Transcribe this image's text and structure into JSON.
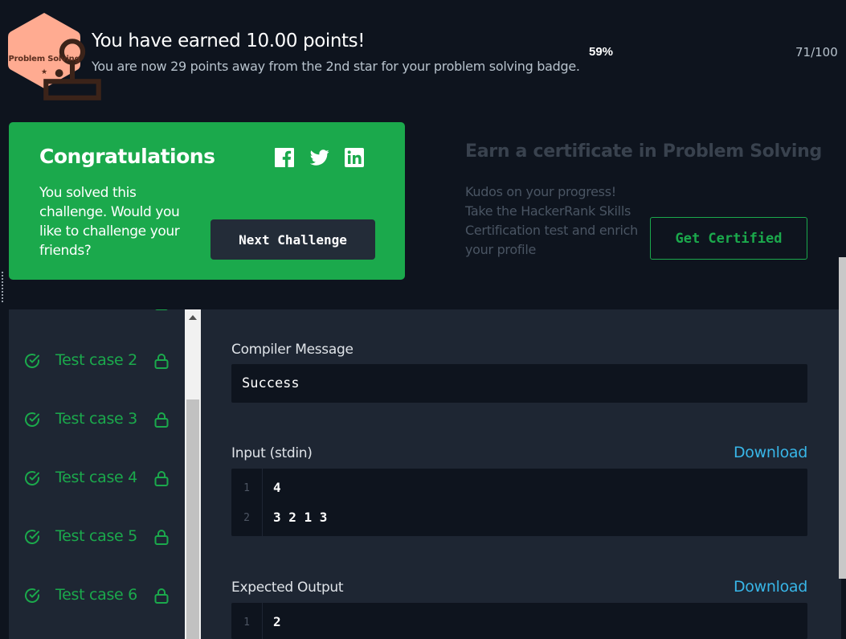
{
  "badge": {
    "name": "Problem Solving",
    "star": "★"
  },
  "points": {
    "earned_text": "You have earned 10.00 points!",
    "away_text": "You are now 29 points away from the 2nd star for your problem solving badge.",
    "percent": "59%",
    "score": "71/100",
    "progress_fraction": 0.59
  },
  "congrats": {
    "title": "Congratulations",
    "text": "You solved this challenge. Would you like to challenge your friends?",
    "next_button": "Next Challenge",
    "social_icons": [
      "facebook-icon",
      "twitter-icon",
      "linkedin-icon"
    ]
  },
  "certificate": {
    "title": "Earn a certificate in Problem Solving",
    "text": "Kudos on your progress! Take the HackerRank Skills Certification test and enrich your profile",
    "button": "Get Certified"
  },
  "test_cases": [
    {
      "label": "Test case 2"
    },
    {
      "label": "Test case 3"
    },
    {
      "label": "Test case 4"
    },
    {
      "label": "Test case 5"
    },
    {
      "label": "Test case 6"
    }
  ],
  "result": {
    "compiler_label": "Compiler Message",
    "compiler_message": "Success",
    "input_label": "Input (stdin)",
    "input_download": "Download",
    "input_lines": [
      {
        "num": "1",
        "text": "4"
      },
      {
        "num": "2",
        "text": "3 2 1 3"
      }
    ],
    "expected_label": "Expected Output",
    "expected_download": "Download",
    "expected_lines": [
      {
        "num": "1",
        "text": "2"
      }
    ]
  },
  "colors": {
    "success_green": "#1ba94c",
    "background": "#0e141e",
    "panel": "#1e2633",
    "link_blue": "#38b6e8",
    "badge_fill": "#ffab91"
  }
}
